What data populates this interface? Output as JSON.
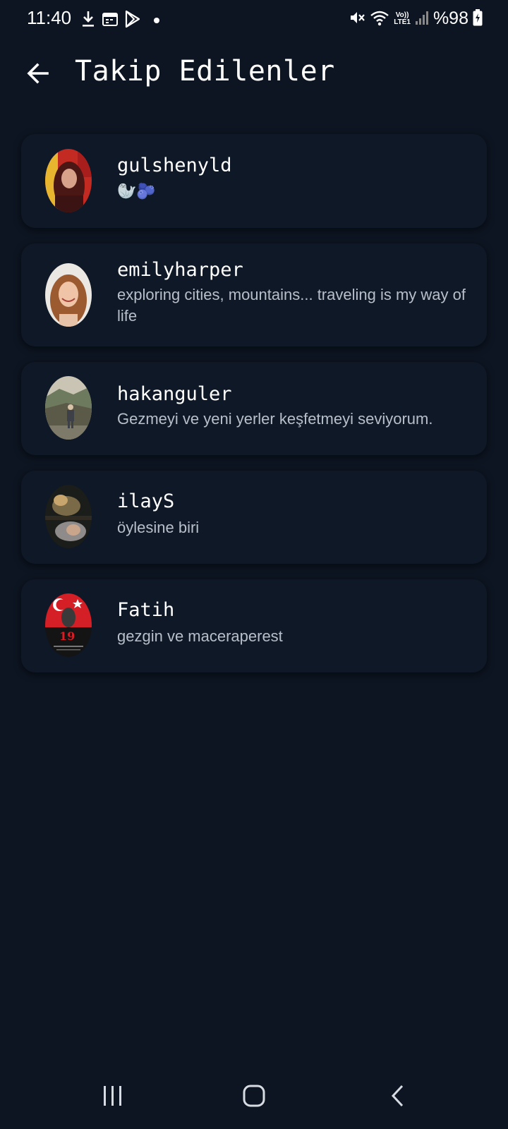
{
  "status_bar": {
    "time": "11:40",
    "battery": "%98",
    "icons_left": [
      "download-icon",
      "calendar-icon",
      "play-store-icon",
      "dot-icon"
    ],
    "icons_right": [
      "mute-icon",
      "wifi-icon",
      "volte-lte-icon",
      "signal-icon",
      "battery-charging-icon"
    ],
    "network_label_top": "Vo))",
    "network_label_bottom": "LTE1"
  },
  "header": {
    "title": "Takip Edilenler"
  },
  "following": [
    {
      "username": "gulshenyld",
      "bio": "🦭🫐"
    },
    {
      "username": "emilyharper",
      "bio": "exploring cities, mountains... traveling is my way of life"
    },
    {
      "username": "hakanguler",
      "bio": "Gezmeyi ve yeni yerler keşfetmeyi seviyorum."
    },
    {
      "username": "ilayS",
      "bio": "öylesine biri"
    },
    {
      "username": "Fatih",
      "bio": "gezgin ve maceraperest"
    }
  ],
  "nav_bar": {
    "buttons": [
      "recent-apps-icon",
      "home-icon",
      "back-icon"
    ]
  },
  "colors": {
    "background": "#0d1522",
    "card": "#0f1826",
    "text_primary": "#ffffff",
    "text_secondary": "#b8bfcb"
  }
}
